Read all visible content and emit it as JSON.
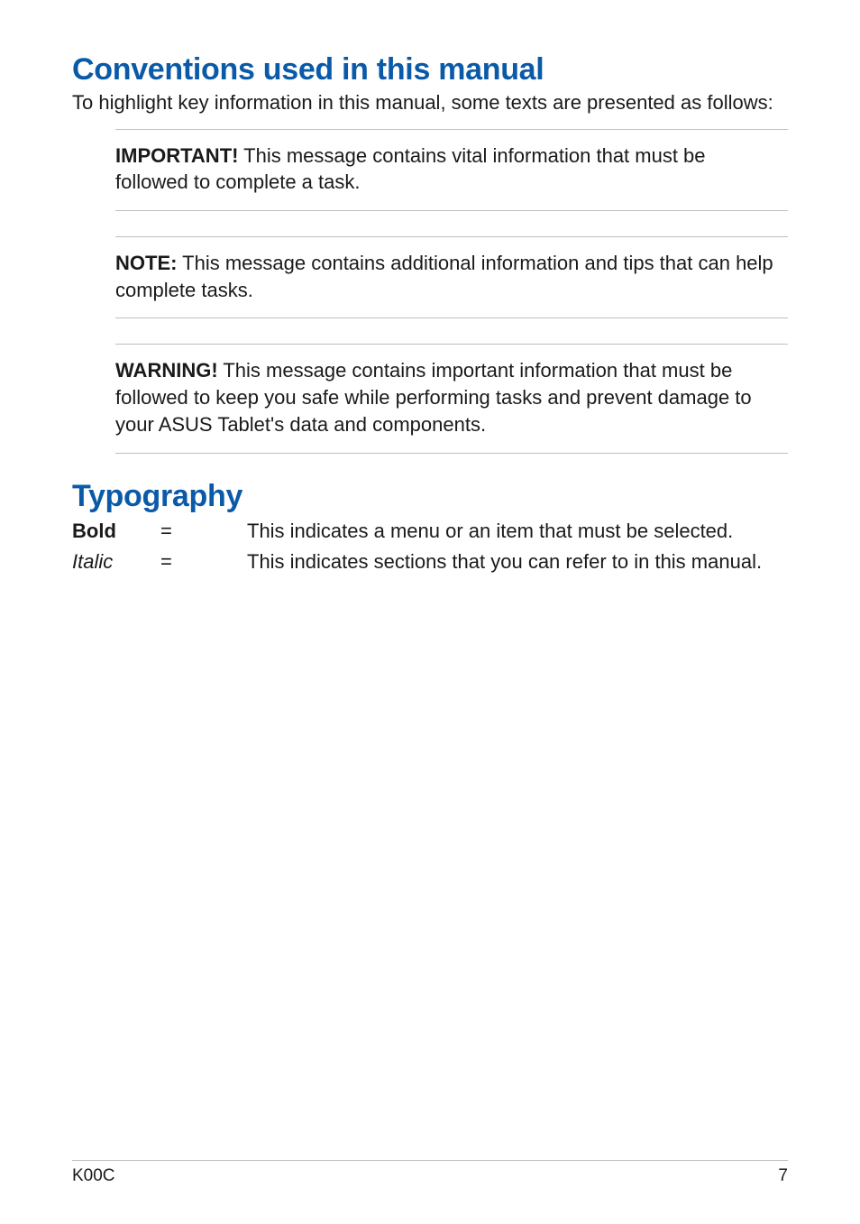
{
  "sections": {
    "conventions": {
      "heading": "Conventions used in this manual",
      "intro": "To highlight key information in this manual, some texts are presented as follows:",
      "notes": [
        {
          "label": "IMPORTANT!",
          "text": "  This message contains vital information that must be followed to complete a task."
        },
        {
          "label": "NOTE:",
          "text": "  This message contains additional information and tips that can help complete tasks."
        },
        {
          "label": "WARNING!",
          "text": "  This message contains important information that must be followed to keep you safe while performing tasks and prevent damage to your ASUS Tablet's data and components."
        }
      ]
    },
    "typography": {
      "heading": "Typography",
      "rows": [
        {
          "term": "Bold",
          "style": "bold",
          "eq": "=",
          "desc": "This indicates a menu or an item that must be selected."
        },
        {
          "term": "Italic",
          "style": "italic",
          "eq": "=",
          "desc": "This indicates sections that you can refer to in this manual."
        }
      ]
    }
  },
  "footer": {
    "model": "K00C",
    "page": "7"
  }
}
